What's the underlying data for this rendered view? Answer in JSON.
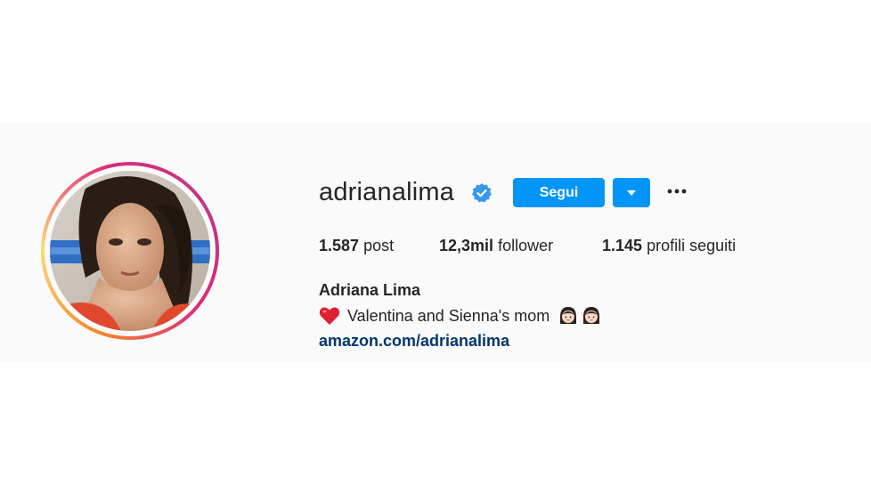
{
  "profile": {
    "username": "adrianalima",
    "full_name": "Adriana Lima",
    "bio_text": "Valentina and Sienna's mom",
    "link": "amazon.com/adrianalima",
    "verified": true
  },
  "actions": {
    "follow_label": "Segui"
  },
  "stats": {
    "posts_count": "1.587",
    "posts_label": "post",
    "followers_count": "12,3mil",
    "followers_label": "follower",
    "following_count": "1.145",
    "following_label": "profili seguiti"
  },
  "icons": {
    "verified": "verified-badge-icon",
    "dropdown": "chevron-down-icon",
    "more": "more-options-icon",
    "heart": "red-heart-emoji",
    "girl": "girl-emoji"
  },
  "colors": {
    "accent": "#0095f6",
    "link": "#00376b",
    "text": "#262626",
    "background": "#fafafa"
  }
}
